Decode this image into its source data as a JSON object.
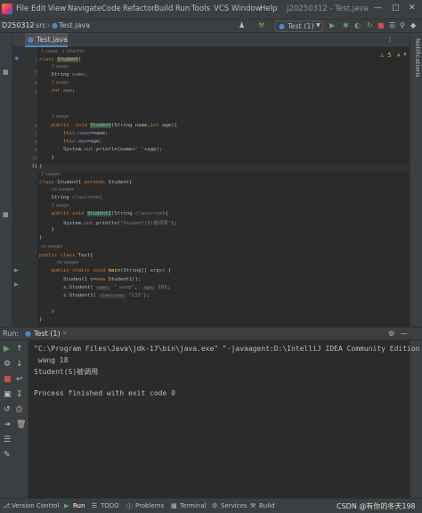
{
  "menu": {
    "items": [
      "File",
      "Edit",
      "View",
      "Navigate",
      "Code",
      "Refactor",
      "Build",
      "Run",
      "Tools",
      "VCS",
      "Window",
      "Help"
    ],
    "title": "J20250312 - Test.java"
  },
  "navbar": {
    "project": "D250312",
    "src": "src",
    "file": "Test.java",
    "run_config": "Test (1)"
  },
  "tab": {
    "label": "Test.java"
  },
  "notifications_label": "Notifications",
  "warnings": {
    "count": "⚠ 5"
  },
  "code": {
    "lines": [
      {
        "n": "1",
        "hint": "1 usage   1 inheritor"
      },
      {
        "n": "2",
        "text": "class Student{"
      },
      {
        "n": "3",
        "hint": "1 usage",
        "text": "    String name;"
      },
      {
        "n": "4",
        "hint": "1 usage",
        "text": "    int age;"
      },
      {
        "n": "5",
        "text": ""
      },
      {
        "n": "6",
        "hint": "1 usage",
        "text": "    public  void Student(String name,int age){"
      },
      {
        "n": "7",
        "text": "        this.name=name;"
      },
      {
        "n": "8",
        "text": "        this.age=age;"
      },
      {
        "n": "9",
        "text": "        System.out.println(name+\" \"+age);"
      },
      {
        "n": "10",
        "text": "    }"
      },
      {
        "n": "11",
        "text": "}"
      },
      {
        "n": "12",
        "hint": "2 usages",
        "text": "class Student1 extends Student{"
      },
      {
        "n": "13",
        "hint": "no usages",
        "text": "    String classroom;"
      },
      {
        "n": "14",
        "hint": "1 usage",
        "text": "    public void Student1(String classroom){"
      },
      {
        "n": "15",
        "text": "        System.out.println(\"Student(S)被调用\");"
      },
      {
        "n": "16",
        "text": "    }"
      },
      {
        "n": "17",
        "text": "}"
      },
      {
        "n": "18",
        "hint": "no usages",
        "text": "public class Test{"
      },
      {
        "n": "19",
        "hint": "no usages",
        "text": "    public static void main(String[] args) {"
      },
      {
        "n": "20",
        "text": "        Student1 s=new Student1();"
      },
      {
        "n": "21",
        "text": "        s.Student( name: \" wang\",  age: 18);"
      },
      {
        "n": "22",
        "text": "        s.Student1( classroom: \"133\");"
      },
      {
        "n": "23",
        "text": ""
      },
      {
        "n": "24",
        "text": "    }"
      },
      {
        "n": "25",
        "text": "}"
      }
    ]
  },
  "run_panel": {
    "label": "Run:",
    "tab": "Test (1)",
    "console": [
      "\"C:\\Program Files\\Java\\jdk-17\\bin\\java.exe\" \"-javaagent:D:\\IntelliJ IDEA Community Edition 20",
      " wang 18",
      "Student(S)被调用",
      "",
      "Process finished with exit code 0"
    ]
  },
  "bottom_bar": {
    "items": [
      "Version Control",
      "Run",
      "TODO",
      "Problems",
      "Terminal",
      "Services",
      "Build"
    ],
    "watermark": "CSDN @有你的冬天198"
  }
}
